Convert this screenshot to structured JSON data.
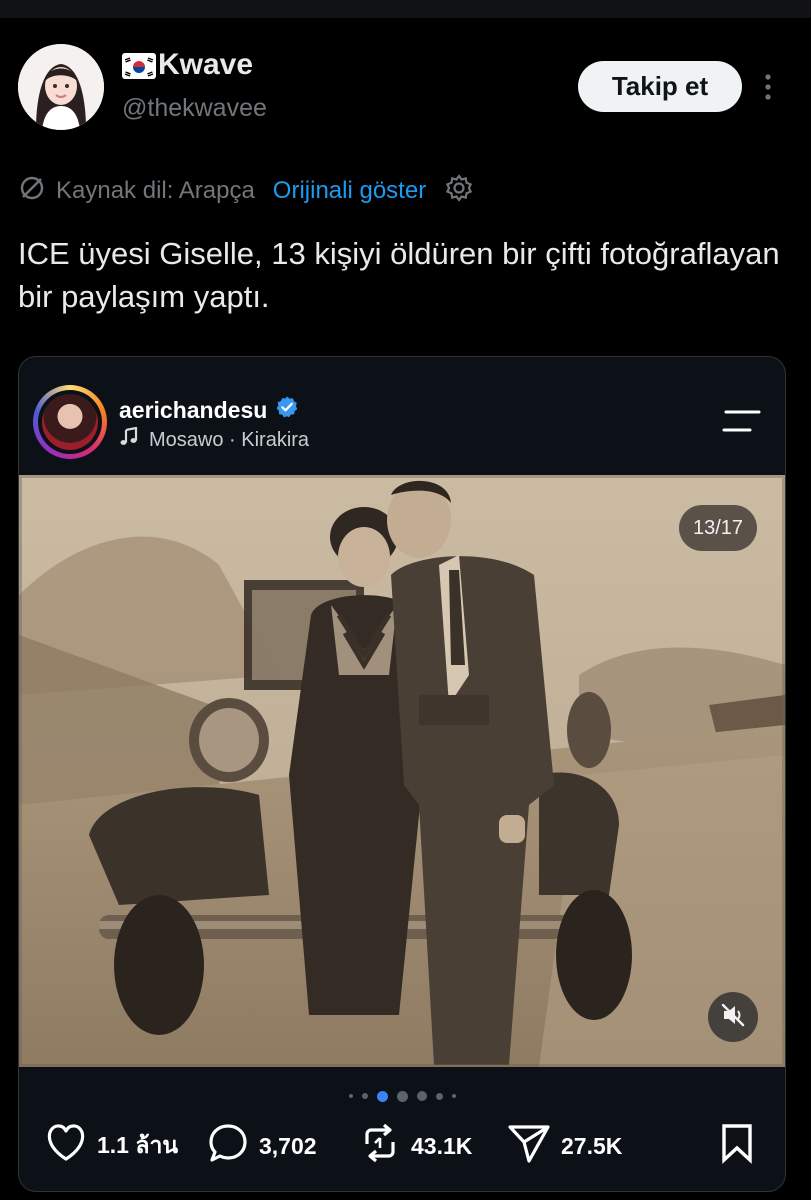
{
  "author": {
    "name": "Kwave",
    "flag_icon": "south-korea-flag-icon",
    "handle": "@thekwavee"
  },
  "follow_button": {
    "label": "Takip et"
  },
  "translation": {
    "source_label": "Kaynak dil: Arapça",
    "show_original_label": "Orijinali göster"
  },
  "tweet": {
    "text": "ICE üyesi Giselle, 13 kişiyi öldüren bir çifti fotoğraflayan bir paylaşım yaptı."
  },
  "embed": {
    "username": "aerichandesu",
    "verified": true,
    "music": "Mosawo · Kirakira",
    "counter": "13/17",
    "carousel_active_index": 2,
    "carousel_dot_count": 7,
    "actions": {
      "likes": "1.1 ล้าน",
      "comments": "3,702",
      "reposts": "43.1K",
      "shares": "27.5K"
    }
  },
  "colors": {
    "background": "#000000",
    "link_blue": "#1d9bf0",
    "muted_text": "#71767b",
    "verified_blue": "#3897f0"
  }
}
